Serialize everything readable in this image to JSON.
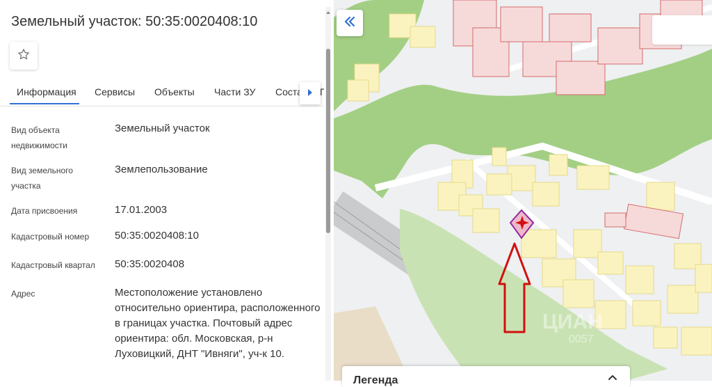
{
  "panel": {
    "title": "Земельный участок: 50:35:0020408:10",
    "favorite_icon": "star-outline-icon",
    "tabs": [
      {
        "label": "Информация",
        "active": true
      },
      {
        "label": "Сервисы",
        "active": false
      },
      {
        "label": "Объекты",
        "active": false
      },
      {
        "label": "Части ЗУ",
        "active": false
      },
      {
        "label": "Соста",
        "active": false
      },
      {
        "label": "Г",
        "active": false
      }
    ],
    "tabs_next_icon": "triangle-right-icon",
    "fields": [
      {
        "label": "Вид объекта недвижимости",
        "value": "Земельный участок"
      },
      {
        "label": "Вид земельного участка",
        "value": "Землепользование"
      },
      {
        "label": "Дата присвоения",
        "value": "17.01.2003"
      },
      {
        "label": "Кадастровый номер",
        "value": "50:35:0020408:10"
      },
      {
        "label": "Кадастровый квартал",
        "value": "50:35:0020408"
      },
      {
        "label": "Адрес",
        "value": "Местоположение установлено относительно ориентира, расположенного в границах участка. Почтовый адрес ориентира: обл. Московская, р-н Луховицкий, ДНТ \"Ивняги\", уч-к 10."
      }
    ]
  },
  "map": {
    "collapse_icon": "double-chevron-left-icon",
    "watermark": "ЦИАН",
    "watermark_sub": "0057",
    "legend_title": "Легенда",
    "legend_icon": "chevron-up-icon",
    "colors": {
      "green": "#a3cf84",
      "light_green": "#c9e2b3",
      "yellow_parcel": "#fbf3bf",
      "yellow_border": "#e6d98a",
      "red_parcel": "#f6dada",
      "red_border": "#d76a6a",
      "selected_parcel": "#8f2a9f",
      "arrow": "#d10f0f",
      "rail": "#c9cbcd"
    }
  }
}
